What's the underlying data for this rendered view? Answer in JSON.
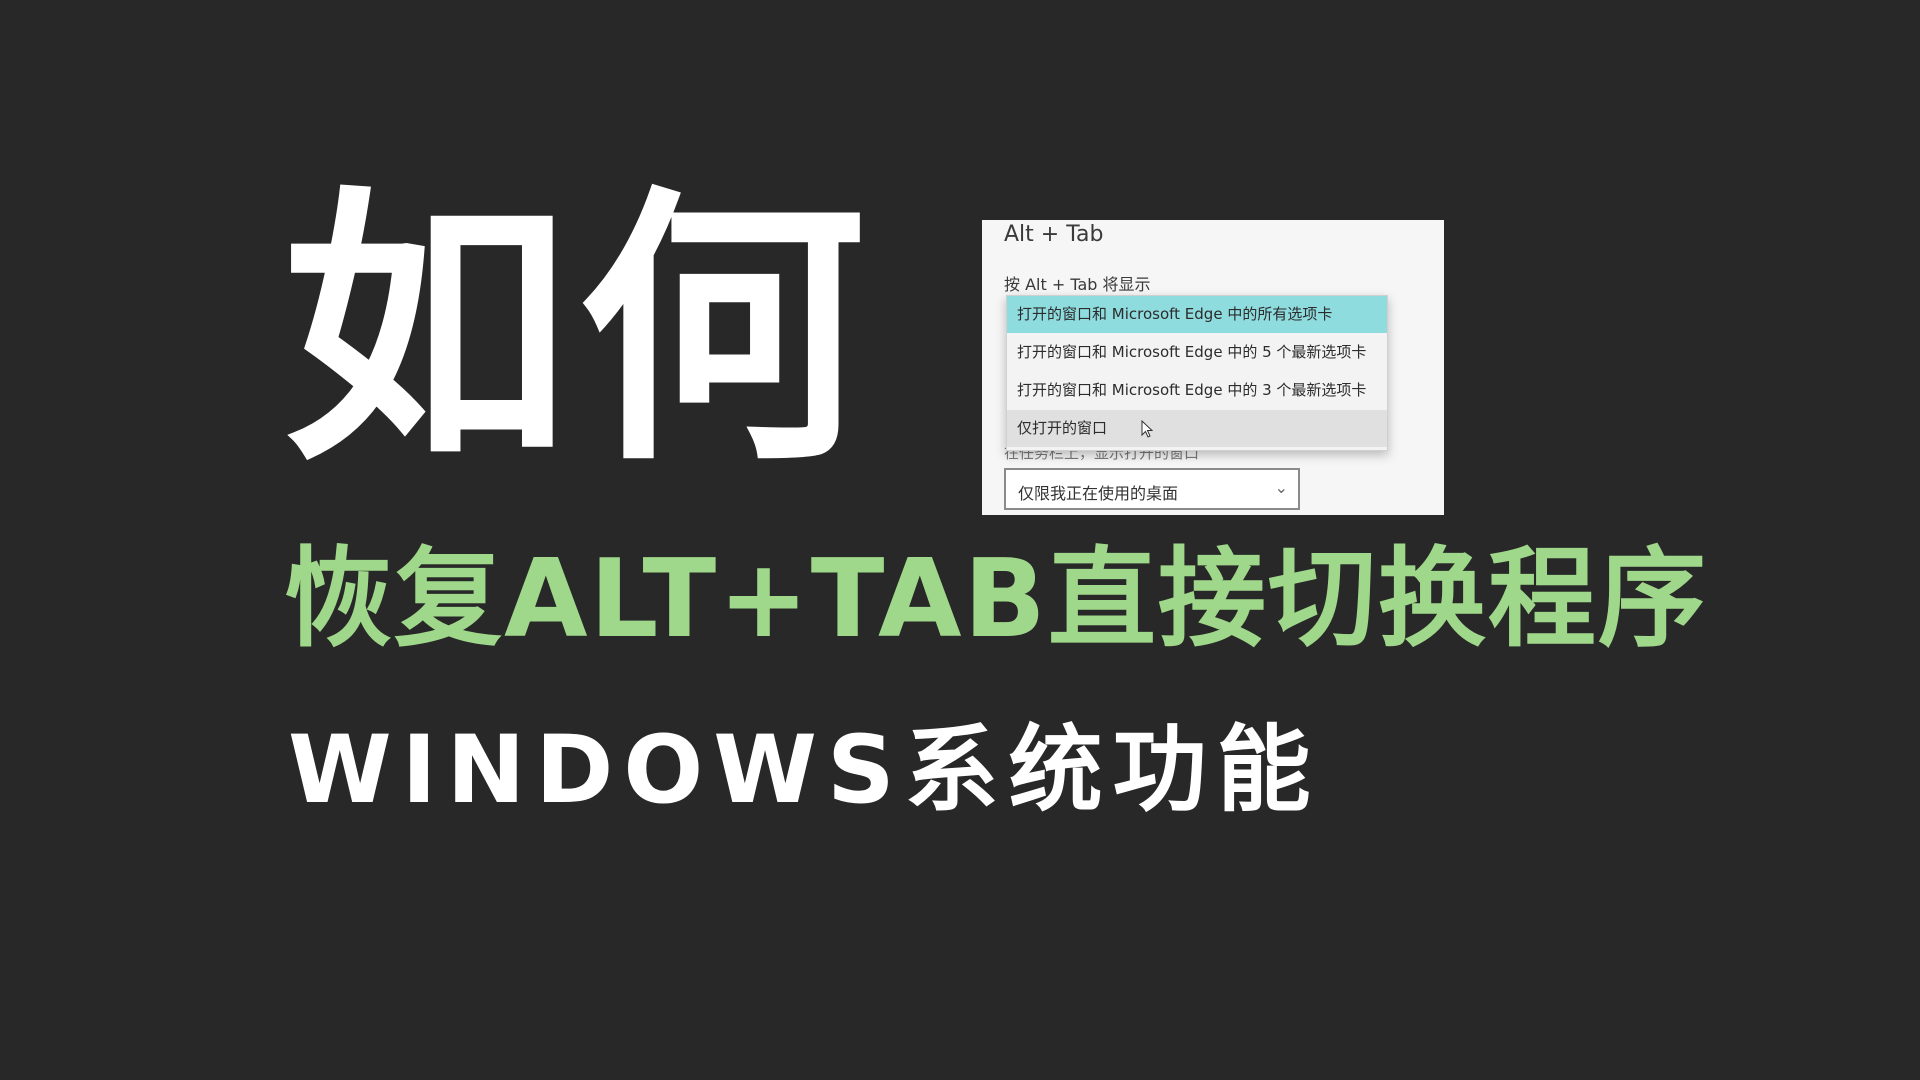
{
  "headline": {
    "title": "如何",
    "subtitle": "恢复ALT+TAB直接切换程序",
    "tagline": "WINDOWS系统功能"
  },
  "settings_panel": {
    "heading": "Alt + Tab",
    "label": "按 Alt + Tab 将显示",
    "dropdown_options": [
      "打开的窗口和 Microsoft Edge 中的所有选项卡",
      "打开的窗口和 Microsoft Edge 中的 5 个最新选项卡",
      "打开的窗口和 Microsoft Edge 中的 3 个最新选项卡",
      "仅打开的窗口"
    ],
    "selected_option_index": 0,
    "hovered_option_index": 3,
    "hidden_label": "在任务栏上，显示打开的窗口",
    "second_select_value": "仅限我正在使用的桌面"
  },
  "colors": {
    "background": "#282828",
    "title": "#ffffff",
    "subtitle": "#9fd88a",
    "selected_option": "#8fdcdf"
  },
  "icons": {
    "pointer": "mouse-pointer-icon",
    "dropdown": "chevron-down-icon"
  }
}
